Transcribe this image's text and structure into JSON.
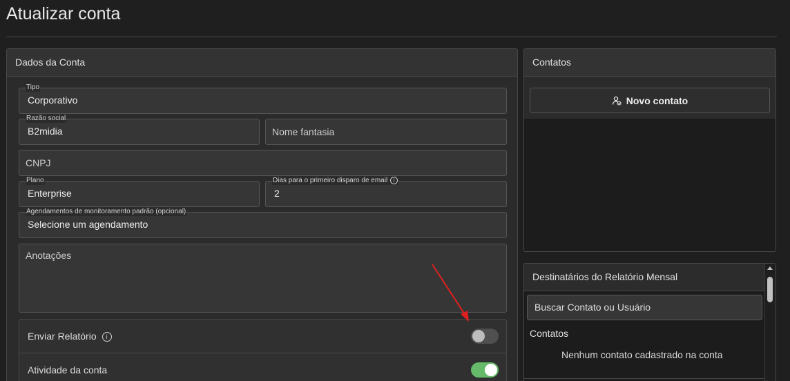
{
  "page": {
    "title": "Atualizar conta"
  },
  "account_panel": {
    "header": "Dados da Conta",
    "fields": {
      "tipo": {
        "label": "Tipo",
        "value": "Corporativo"
      },
      "razao_social": {
        "label": "Razão social",
        "value": "B2midia"
      },
      "nome_fantasia": {
        "placeholder": "Nome fantasia"
      },
      "cnpj": {
        "placeholder": "CNPJ"
      },
      "plano": {
        "label": "Plano",
        "value": "Enterprise"
      },
      "dias": {
        "label": "Dias para o primeiro disparo de email",
        "value": "2"
      },
      "agendamentos": {
        "label": "Agendamentos de monitoramento padrão (opcional)",
        "value": "Selecione um agendamento"
      },
      "anotacoes": {
        "placeholder": "Anotações"
      }
    },
    "toggles": {
      "enviar_relatorio": {
        "label": "Enviar Relatório",
        "state": "off"
      },
      "atividade_conta": {
        "label": "Atividade da conta",
        "state": "on"
      }
    }
  },
  "contacts_panel": {
    "header": "Contatos",
    "new_contact_button": "Novo contato",
    "icon": "person-add-icon"
  },
  "report_panel": {
    "header": "Destinatários do Relatório Mensal",
    "search_placeholder": "Buscar Contato ou Usuário",
    "contacts_label": "Contatos",
    "empty_message": "Nenhum contato cadastrado na conta"
  },
  "colors": {
    "background": "#1f1f1f",
    "panel": "#2b2b2b",
    "toggle_on": "#66bb6a",
    "annotation_arrow": "#e02020"
  }
}
